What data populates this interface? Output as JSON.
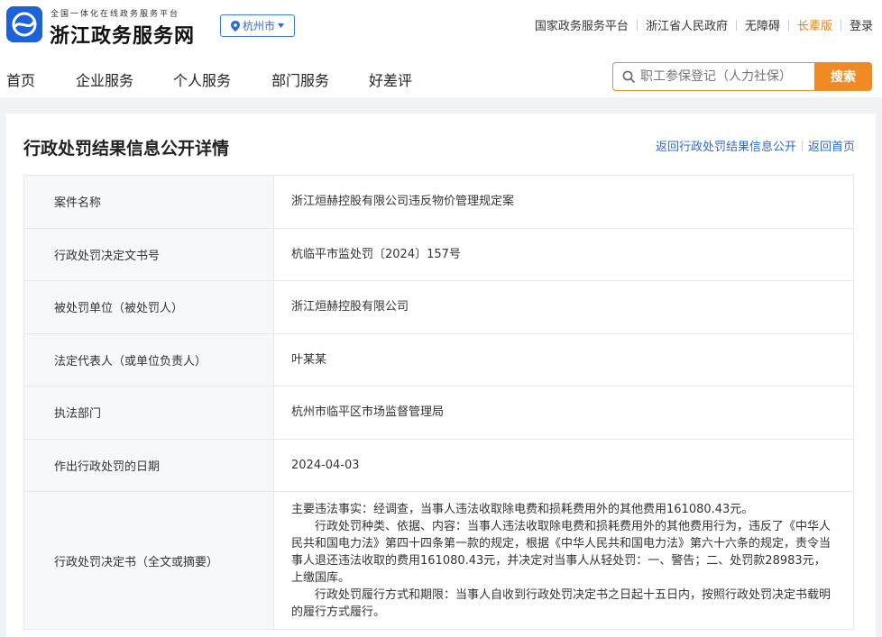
{
  "header": {
    "logo_sub": "全国一体化在线政务服务平台",
    "logo_title": "浙江政务服务网",
    "logo_icon": "globe-swirl-icon",
    "brand_color": "#1d63d8",
    "city": "杭州市",
    "top_links": [
      "国家政务服务平台",
      "浙江省人民政府",
      "无障碍",
      "长辈版",
      "登录"
    ]
  },
  "nav": {
    "items": [
      "首页",
      "企业服务",
      "个人服务",
      "部门服务",
      "好差评"
    ],
    "search_placeholder": "职工参保登记（人力社保）",
    "search_button": "搜索",
    "accent_color": "#f08a24"
  },
  "main": {
    "title": "行政处罚结果信息公开详情",
    "back_list": "返回行政处罚结果信息公开",
    "back_home": "返回首页",
    "rows": [
      {
        "label": "案件名称",
        "value": "浙江烜赫控股有限公司违反物价管理规定案"
      },
      {
        "label": "行政处罚决定文书号",
        "value": "杭临平市监处罚〔2024〕157号"
      },
      {
        "label": "被处罚单位（被处罚人）",
        "value": "浙江烜赫控股有限公司"
      },
      {
        "label": "法定代表人（或单位负责人）",
        "value": "叶某某"
      },
      {
        "label": "执法部门",
        "value": "杭州市临平区市场监督管理局"
      },
      {
        "label": "作出行政处罚的日期",
        "value": "2024-04-03"
      }
    ],
    "decision": {
      "label": "行政处罚决定书（全文或摘要）",
      "p1": "主要违法事实：经调查，当事人违法收取除电费和损耗费用外的其他费用161080.43元。",
      "p2": "行政处罚种类、依据、内容：当事人违法收取除电费和损耗费用外的其他费用行为，违反了《中华人民共和国电力法》第四十四条第一款的规定，根据《中华人民共和国电力法》第六十六条的规定，责令当事人退还违法收取的费用161080.43元，并决定对当事人从轻处罚：一、警告；二、处罚款28983元，上缴国库。",
      "p3": "行政处罚履行方式和期限：当事人自收到行政处罚决定书之日起十五日内，按照行政处罚决定书载明的履行方式履行。"
    }
  }
}
